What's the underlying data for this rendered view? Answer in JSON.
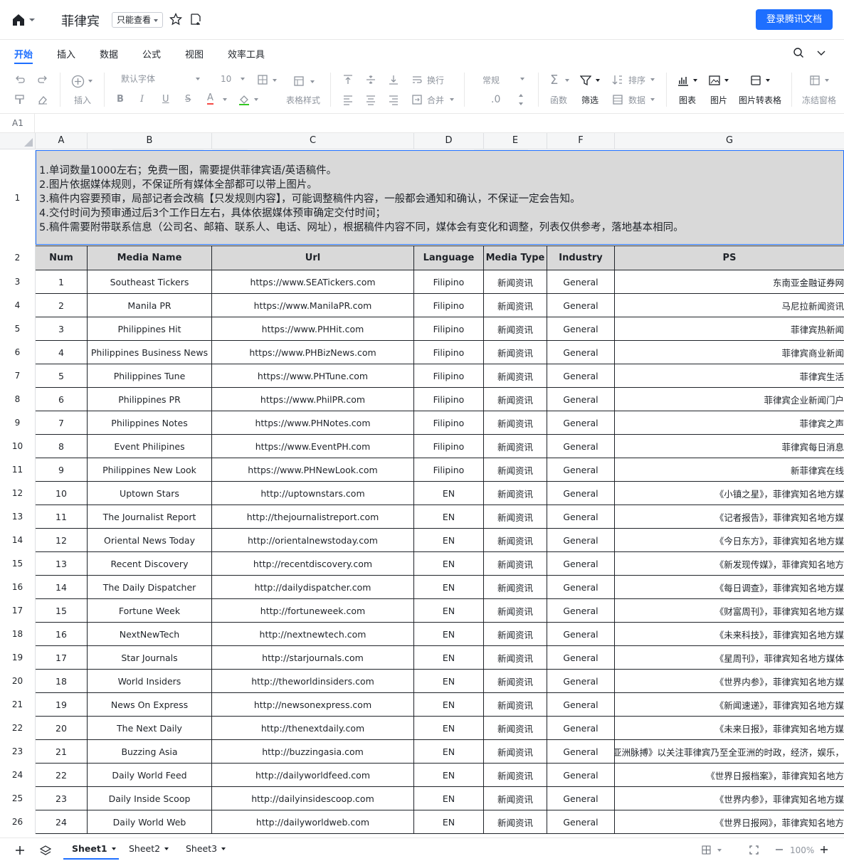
{
  "header": {
    "title": "菲律宾",
    "permission": "只能查看",
    "login_button": "登录腾讯文档"
  },
  "menu_tabs": [
    "开始",
    "插入",
    "数据",
    "公式",
    "视图",
    "效率工具"
  ],
  "toolbar": {
    "insert": "插入",
    "font": "默认字体",
    "font_size": "10",
    "table_style": "表格样式",
    "wrap": "换行",
    "merge": "合并",
    "number_format": "常规",
    "decimal": ".0",
    "function": "函数",
    "filter": "筛选",
    "sort": "排序",
    "data": "数据",
    "chart": "图表",
    "image": "图片",
    "image_to_table": "图片转表格",
    "freeze": "冻结窗格"
  },
  "formula_bar": {
    "cell_ref": "A1"
  },
  "columns": [
    "A",
    "B",
    "C",
    "D",
    "E",
    "F",
    "G"
  ],
  "notes": [
    "1.单词数量1000左右；免费一图，需要提供菲律宾语/英语稿件。",
    "2.图片依据媒体规则，不保证所有媒体全部都可以带上图片。",
    "3.稿件内容要预审，局部记者会改稿【只发规则内容】，可能调整稿件内容，一般都会通知和确认，不保证一定会告知。",
    "4.交付时间为预审通过后3个工作日左右，具体依据媒体预审确定交付时间；",
    "5.稿件需要附带联系信息（公司名、邮箱、联系人、电话、网址），根据稿件内容不同，媒体会有变化和调整，列表仅供参考，落地基本相同。"
  ],
  "table": {
    "headers": [
      "Num",
      "Media Name",
      "Url",
      "Language",
      "Media Type",
      "Industry",
      "PS"
    ],
    "rows": [
      [
        "1",
        "Southeast Tickers",
        "https://www.SEATickers.com",
        "Filipino",
        "新闻资讯",
        "General",
        "东南亚金融证券网"
      ],
      [
        "2",
        "Manila PR",
        "https://www.ManilaPR.com",
        "Filipino",
        "新闻资讯",
        "General",
        "马尼拉新闻资讯"
      ],
      [
        "3",
        "Philippines Hit",
        "https://www.PHHit.com",
        "Filipino",
        "新闻资讯",
        "General",
        "菲律宾热新闻"
      ],
      [
        "4",
        "Philippines Business News",
        "https://www.PHBizNews.com",
        "Filipino",
        "新闻资讯",
        "General",
        "菲律宾商业新闻"
      ],
      [
        "5",
        "Philippines Tune",
        "https://www.PHTune.com",
        "Filipino",
        "新闻资讯",
        "General",
        "菲律宾生活"
      ],
      [
        "6",
        "Philippines PR",
        "https://www.PhilPR.com",
        "Filipino",
        "新闻资讯",
        "General",
        "菲律宾企业新闻门户"
      ],
      [
        "7",
        "Philippines Notes",
        "https://www.PHNotes.com",
        "Filipino",
        "新闻资讯",
        "General",
        "菲律宾之声"
      ],
      [
        "8",
        "Event Philipines",
        "https://www.EventPH.com",
        "Filipino",
        "新闻资讯",
        "General",
        "菲律宾每日消息"
      ],
      [
        "9",
        "Philippines New Look",
        "https://www.PHNewLook.com",
        "Filipino",
        "新闻资讯",
        "General",
        "新菲律宾在线"
      ],
      [
        "10",
        "Uptown Stars",
        "http://uptownstars.com",
        "EN",
        "新闻资讯",
        "General",
        "《小镇之星》，菲律宾知名地方媒"
      ],
      [
        "11",
        "The Journalist Report",
        "http://thejournalistreport.com",
        "EN",
        "新闻资讯",
        "General",
        "《记者报告》，菲律宾知名地方媒"
      ],
      [
        "12",
        "Oriental News Today",
        "http://orientalnewstoday.com",
        "EN",
        "新闻资讯",
        "General",
        "《今日东方》，菲律宾知名地方媒"
      ],
      [
        "13",
        "Recent Discovery",
        "http://recentdiscovery.com",
        "EN",
        "新闻资讯",
        "General",
        "《新发现传媒》，菲律宾知名地方"
      ],
      [
        "14",
        "The Daily Dispatcher",
        "http://dailydispatcher.com",
        "EN",
        "新闻资讯",
        "General",
        "《每日调查》，菲律宾知名地方媒"
      ],
      [
        "15",
        "Fortune Week",
        "http://fortuneweek.com",
        "EN",
        "新闻资讯",
        "General",
        "《财富周刊》，菲律宾知名地方媒"
      ],
      [
        "16",
        "NextNewTech",
        "http://nextnewtech.com",
        "EN",
        "新闻资讯",
        "General",
        "《未来科技》，菲律宾知名地方媒"
      ],
      [
        "17",
        "Star Journals",
        "http://starjournals.com",
        "EN",
        "新闻资讯",
        "General",
        "《星周刊》，菲律宾知名地方媒体"
      ],
      [
        "18",
        "World Insiders",
        "http://theworldinsiders.com",
        "EN",
        "新闻资讯",
        "General",
        "《世界内参》，菲律宾知名地方媒"
      ],
      [
        "19",
        "News On Express",
        "http://newsonexpress.com",
        "EN",
        "新闻资讯",
        "General",
        "《新闻速递》，菲律宾知名地方媒"
      ],
      [
        "20",
        "The Next Daily",
        "http://thenextdaily.com",
        "EN",
        "新闻资讯",
        "General",
        "《未来日报》，菲律宾知名地方媒"
      ],
      [
        "21",
        "Buzzing Asia",
        "http://buzzingasia.com",
        "EN",
        "新闻资讯",
        "General",
        "《亚洲脉搏》以关注菲律宾乃至全亚洲的时政，经济，娱乐，"
      ],
      [
        "22",
        "Daily World Feed",
        "http://dailyworldfeed.com",
        "EN",
        "新闻资讯",
        "General",
        "《世界日报档案》，菲律宾知名地方"
      ],
      [
        "23",
        "Daily Inside Scoop",
        "http://dailyinsidescoop.com",
        "EN",
        "新闻资讯",
        "General",
        "《世界内参》，菲律宾知名地方媒"
      ],
      [
        "24",
        "Daily World Web",
        "http://dailyworldweb.com",
        "EN",
        "新闻资讯",
        "General",
        "《世界日报网》，菲律宾知名地方"
      ]
    ]
  },
  "sheets": [
    "Sheet1",
    "Sheet2",
    "Sheet3"
  ],
  "zoom": "100%"
}
